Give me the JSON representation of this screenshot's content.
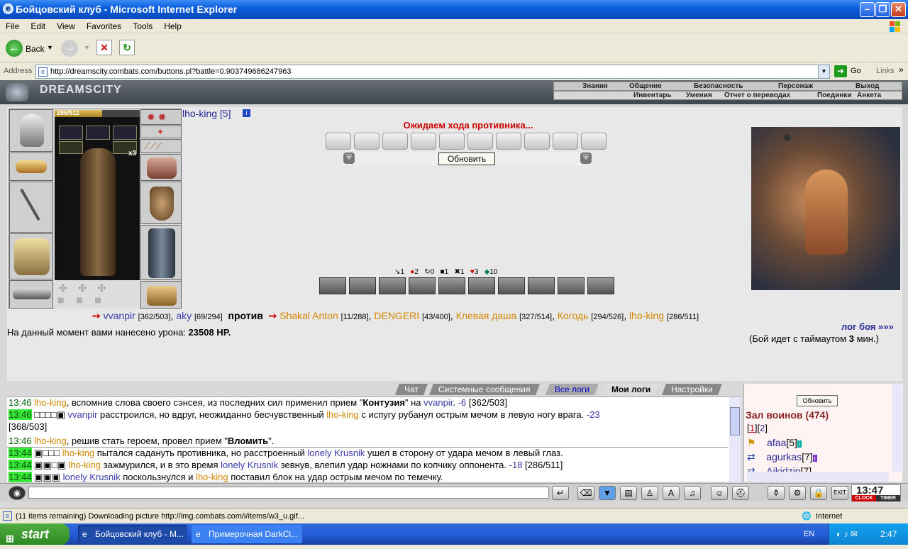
{
  "window": {
    "title": "Бойцовский клуб - Microsoft Internet Explorer"
  },
  "menu": [
    "File",
    "Edit",
    "View",
    "Favorites",
    "Tools",
    "Help"
  ],
  "toolbar": {
    "back": "Back"
  },
  "address": {
    "label": "Address",
    "url": "http://dreamscity.combats.com/buttons.pl?battle=0.903749686247963",
    "go": "Go",
    "links": "Links"
  },
  "game": {
    "logo": "DREAMSCITY",
    "nav_top": [
      "Знания",
      "Общение",
      "Безопасность",
      "Персонаж",
      "Выход"
    ],
    "nav_sub": [
      "Инвентарь",
      "Умения",
      "Отчет о переводах",
      "Поединки",
      "Анкета"
    ],
    "hp": "286/511",
    "hp_fraction": 0.56,
    "char_name": "lho-king [5]",
    "x3": "x3",
    "waiting": "Ожидаем хода противника...",
    "refresh": "Обновить",
    "stats": [
      {
        "icon": "↘",
        "v": "1"
      },
      {
        "icon": "●",
        "v": "2"
      },
      {
        "icon": "↻",
        "v": "0"
      },
      {
        "icon": "■",
        "v": "1"
      },
      {
        "icon": "✖",
        "v": "1"
      },
      {
        "icon": "♥",
        "v": "3"
      },
      {
        "icon": "◆",
        "v": "10"
      }
    ],
    "team1": [
      {
        "n": "vvanpir",
        "s": "[362/503]"
      },
      {
        "n": "aky",
        "s": "[69/294]"
      }
    ],
    "vs": "против",
    "team2": [
      {
        "n": "Shakal Anton",
        "s": "[11/288]"
      },
      {
        "n": "DENGERI",
        "s": "[43/400]"
      },
      {
        "n": "Клевая даша",
        "s": "[327/514]"
      },
      {
        "n": "Когодь",
        "s": "[294/526]"
      },
      {
        "n": "lho-king",
        "s": "[286/511]"
      }
    ],
    "damage_label": "На данный момент вами нанесено урона:",
    "damage_value": "23508 HP.",
    "battle_log_link": "лог боя »»»",
    "timeout_a": "(Бой идет с таймаутом",
    "timeout_n": "3",
    "timeout_b": "мин.)"
  },
  "tabs": [
    "Чат",
    "Системные сообщения",
    "Все логи",
    "Мои логи",
    "Настройки"
  ],
  "log": [
    {
      "t": "13:46",
      "hl": false,
      "p": [
        [
          "n",
          "lho-king"
        ],
        [
          "x",
          ", вспомнив слова своего сэнсея, из последних сил применил прием \""
        ],
        [
          "b",
          "Контузия"
        ],
        [
          "x",
          "\" на "
        ],
        [
          "v",
          "vvanpir"
        ],
        [
          "x",
          ". "
        ],
        [
          "v",
          "-6"
        ],
        [
          "x",
          " [362/503]"
        ]
      ]
    },
    {
      "t": "13:46",
      "hl": true,
      "p": [
        [
          "x",
          "□□□□▣ "
        ],
        [
          "v",
          "vvanpir"
        ],
        [
          "x",
          " расстроился, но вдруг, неожиданно бесчувственный "
        ],
        [
          "n",
          "lho-king"
        ],
        [
          "x",
          " с испугу рубанул острым мечом в левую ногу врага. "
        ],
        [
          "v",
          "-23"
        ]
      ]
    },
    {
      "t": "",
      "hl": false,
      "p": [
        [
          "x",
          "[368/503]"
        ]
      ]
    },
    {
      "t": "13:46",
      "hl": false,
      "p": [
        [
          "n",
          "lho-king"
        ],
        [
          "x",
          ", решив стать героем, провел прием \""
        ],
        [
          "b",
          "Вломить"
        ],
        [
          "x",
          "\"."
        ]
      ]
    },
    {
      "t": "13:44",
      "hl": true,
      "p": [
        [
          "x",
          "▣□□□ "
        ],
        [
          "n",
          "lho-king"
        ],
        [
          "x",
          " пытался садануть противника, но расстроенный "
        ],
        [
          "v",
          "lonely Krusnik"
        ],
        [
          "x",
          " ушел в сторону от удара мечом в левый глаз."
        ]
      ]
    },
    {
      "t": "13:44",
      "hl": true,
      "p": [
        [
          "x",
          "▣▣□▣ "
        ],
        [
          "n",
          "lho-king"
        ],
        [
          "x",
          " зажмурился, и в это время "
        ],
        [
          "v",
          "lonely Krusnik"
        ],
        [
          "x",
          " зевнув, влепил удар ножнами по копчику оппонента. "
        ],
        [
          "v",
          "-18"
        ],
        [
          "x",
          " [286/511]"
        ]
      ]
    },
    {
      "t": "13:44",
      "hl": true,
      "p": [
        [
          "x",
          "▣▣▣ "
        ],
        [
          "v",
          "lonely Krusnik"
        ],
        [
          "x",
          " поскользнулся и "
        ],
        [
          "n",
          "lho-king"
        ],
        [
          "x",
          " поставил блок на удар острым мечом по темечку."
        ]
      ]
    }
  ],
  "room": {
    "refresh": "Обновить",
    "title": "Зал воинов (474)",
    "pages": [
      "1",
      "2"
    ],
    "users": [
      {
        "n": "afaa",
        "l": "[5]"
      },
      {
        "n": "agurkas",
        "l": "[7]"
      },
      {
        "n": "Aikidzin",
        "l": "[7]"
      }
    ]
  },
  "clock": {
    "time": "13:47",
    "label_a": "CLOCK",
    "label_b": "TIMER"
  },
  "status": {
    "text": "(11 items remaining) Downloading picture http://img.combats.com/i/items/w3_u.gif...",
    "zone": "Internet"
  },
  "taskbar": {
    "start": "start",
    "tasks": [
      "Бойцовский клуб - M...",
      "Примерочная DarkCl..."
    ],
    "lang": "EN",
    "time": "2:47"
  },
  "colors": {
    "name_orange": "#d58700",
    "name_blue": "#3a3ab0",
    "alert_red": "#cc0000"
  }
}
